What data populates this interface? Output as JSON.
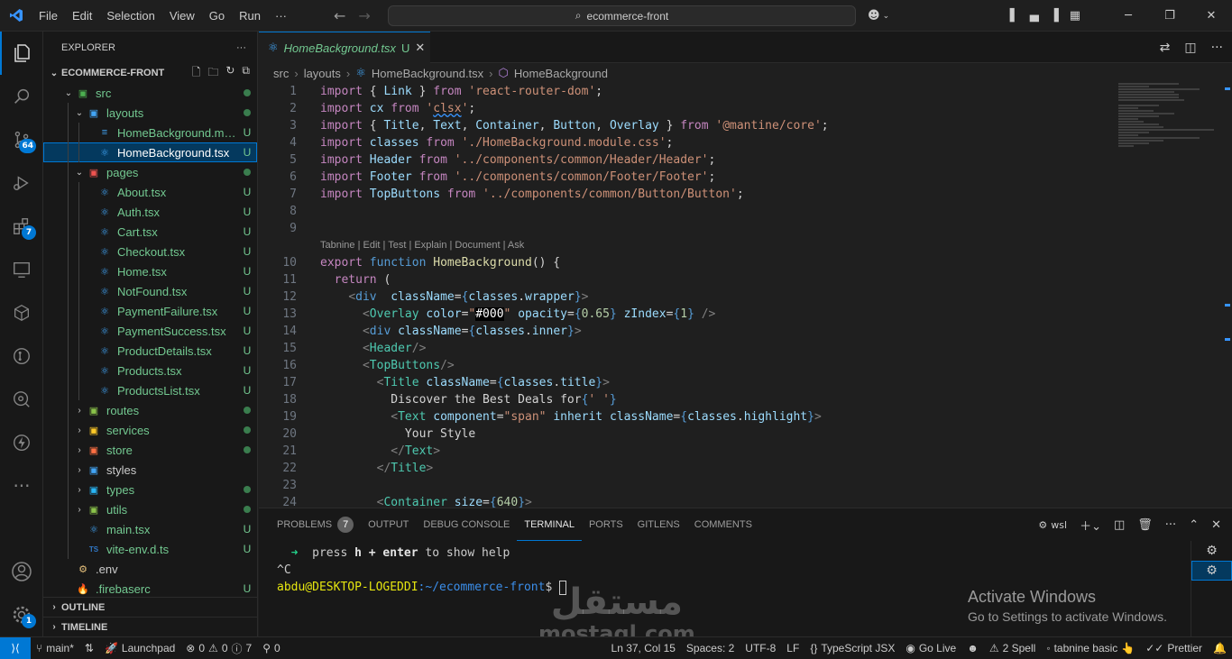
{
  "titlebar": {
    "menu": [
      "File",
      "Edit",
      "Selection",
      "View",
      "Go",
      "Run",
      "···"
    ],
    "search": "ecommerce-front",
    "back_icon": "arrow-left-icon",
    "forward_icon": "arrow-right-icon"
  },
  "activity": {
    "scm_badge": "64",
    "extensions_badge": "7",
    "settings_badge": "1"
  },
  "explorer": {
    "title": "EXPLORER",
    "root": "ECOMMERCE-FRONT",
    "items": [
      {
        "label": "src",
        "depth": 1,
        "kind": "folder-open",
        "status": "dot"
      },
      {
        "label": "layouts",
        "depth": 2,
        "kind": "folder-open",
        "status": "dot"
      },
      {
        "label": "HomeBackground.mo...",
        "depth": 3,
        "kind": "css",
        "status": "U"
      },
      {
        "label": "HomeBackground.tsx",
        "depth": 3,
        "kind": "react",
        "status": "U",
        "selected": true
      },
      {
        "label": "pages",
        "depth": 2,
        "kind": "folder-open",
        "status": "dot"
      },
      {
        "label": "About.tsx",
        "depth": 3,
        "kind": "react",
        "status": "U"
      },
      {
        "label": "Auth.tsx",
        "depth": 3,
        "kind": "react",
        "status": "U"
      },
      {
        "label": "Cart.tsx",
        "depth": 3,
        "kind": "react",
        "status": "U"
      },
      {
        "label": "Checkout.tsx",
        "depth": 3,
        "kind": "react",
        "status": "U"
      },
      {
        "label": "Home.tsx",
        "depth": 3,
        "kind": "react",
        "status": "U"
      },
      {
        "label": "NotFound.tsx",
        "depth": 3,
        "kind": "react",
        "status": "U"
      },
      {
        "label": "PaymentFailure.tsx",
        "depth": 3,
        "kind": "react",
        "status": "U"
      },
      {
        "label": "PaymentSuccess.tsx",
        "depth": 3,
        "kind": "react",
        "status": "U"
      },
      {
        "label": "ProductDetails.tsx",
        "depth": 3,
        "kind": "react",
        "status": "U"
      },
      {
        "label": "Products.tsx",
        "depth": 3,
        "kind": "react",
        "status": "U"
      },
      {
        "label": "ProductsList.tsx",
        "depth": 3,
        "kind": "react",
        "status": "U"
      },
      {
        "label": "routes",
        "depth": 2,
        "kind": "folder",
        "status": "dot"
      },
      {
        "label": "services",
        "depth": 2,
        "kind": "folder",
        "status": "dot"
      },
      {
        "label": "store",
        "depth": 2,
        "kind": "folder",
        "status": "dot"
      },
      {
        "label": "styles",
        "depth": 2,
        "kind": "folder",
        "status": ""
      },
      {
        "label": "types",
        "depth": 2,
        "kind": "folder",
        "status": "dot"
      },
      {
        "label": "utils",
        "depth": 2,
        "kind": "folder",
        "status": "dot"
      },
      {
        "label": "main.tsx",
        "depth": 2,
        "kind": "react",
        "status": "U"
      },
      {
        "label": "vite-env.d.ts",
        "depth": 2,
        "kind": "ts",
        "status": "U"
      },
      {
        "label": ".env",
        "depth": 1,
        "kind": "env",
        "status": ""
      },
      {
        "label": ".firebaserc",
        "depth": 1,
        "kind": "firebase",
        "status": "U"
      }
    ],
    "outline": "OUTLINE",
    "timeline": "TIMELINE"
  },
  "editor": {
    "tab_label": "HomeBackground.tsx",
    "tab_status": "U",
    "breadcrumb": [
      "src",
      "layouts",
      "HomeBackground.tsx",
      "HomeBackground"
    ],
    "codelens": "Tabnine | Edit | Test | Explain | Document | Ask",
    "lines": [
      "1",
      "2",
      "3",
      "4",
      "5",
      "6",
      "7",
      "8",
      "9",
      "10",
      "11",
      "12",
      "13",
      "14",
      "15",
      "16",
      "17",
      "18",
      "19",
      "20",
      "21",
      "22",
      "23",
      "24"
    ]
  },
  "panel": {
    "tabs": [
      "PROBLEMS",
      "OUTPUT",
      "DEBUG CONSOLE",
      "TERMINAL",
      "PORTS",
      "GITLENS",
      "COMMENTS"
    ],
    "problems_count": "7",
    "active_tab": "TERMINAL",
    "terminal_name": "wsl",
    "terminal": {
      "arrow": "➜",
      "press": "press",
      "h": "h",
      "plus": "+",
      "enter": "enter",
      "help": "to show help",
      "ctrl_c": "^C",
      "user": "abdu@DESKTOP-LOGEDDI",
      "path": ":~/ecommerce-front",
      "prompt": "$ "
    },
    "activate_title": "Activate Windows",
    "activate_sub": "Go to Settings to activate Windows.",
    "watermark_ar": "مستقل",
    "watermark_en": "mostaql.com"
  },
  "status": {
    "branch": "main*",
    "launchpad": "Launchpad",
    "errors": "0",
    "warnings": "0",
    "info": "7",
    "ports": "0",
    "position": "Ln 37, Col 15",
    "spaces": "Spaces: 2",
    "encoding": "UTF-8",
    "eol": "LF",
    "language": "TypeScript JSX",
    "golive": "Go Live",
    "spell": "2 Spell",
    "tabnine": "tabnine basic",
    "prettier": "Prettier"
  },
  "colors": {
    "accent": "#0078d4",
    "untracked": "#73c991",
    "keyword": "#569cd6",
    "string": "#ce9178"
  }
}
